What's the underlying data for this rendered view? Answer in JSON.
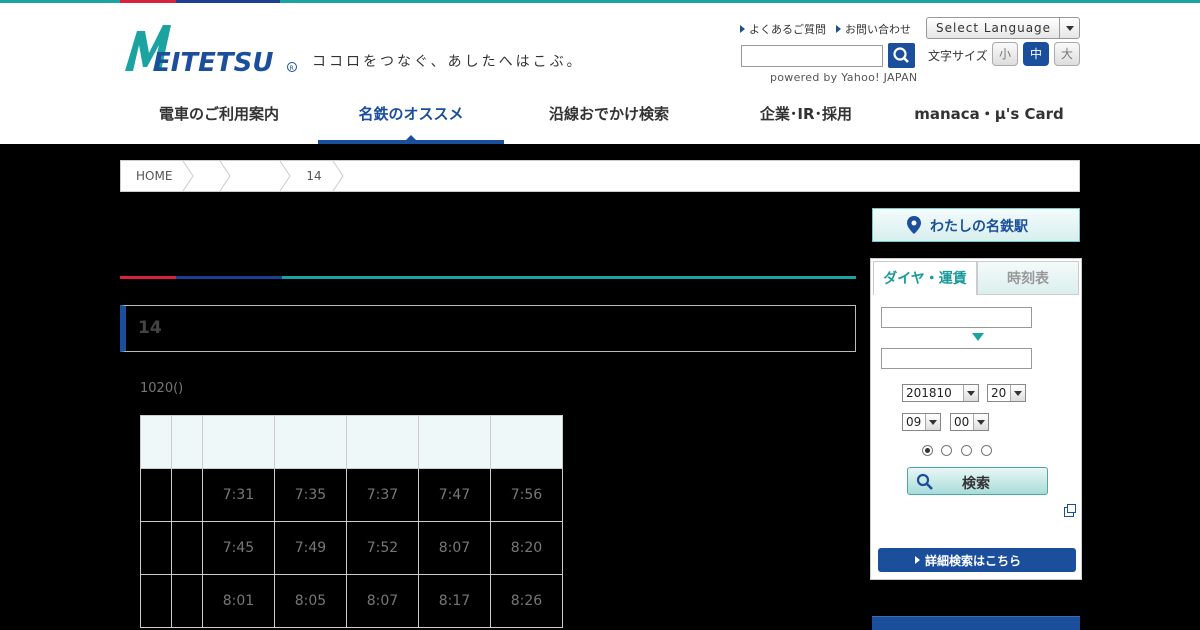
{
  "header": {
    "logo_text": "MEITETSU",
    "tagline": "ココロをつなぐ、あしたへはこぶ。",
    "util_links": [
      "よくあるご質問",
      "お問い合わせ"
    ],
    "language_select": "Select Language",
    "search_placeholder": "",
    "powered_by": "powered by Yahoo! JAPAN",
    "fontsize_label": "文字サイズ",
    "fontsize_small": "小",
    "fontsize_medium": "中",
    "fontsize_large": "大",
    "brand_blue": "#1b4f9c",
    "brand_teal": "#1aa3a0",
    "brand_red": "#d9233c"
  },
  "gnav": [
    {
      "label": "電車のご利用案内",
      "active": false
    },
    {
      "label": "名鉄のオススメ",
      "active": true
    },
    {
      "label": "沿線おでかけ検索",
      "active": false
    },
    {
      "label": "企業･IR･採用",
      "active": false
    },
    {
      "label": "manaca・μ's Card",
      "active": false
    }
  ],
  "breadcrumb": [
    "HOME",
    "",
    "",
    "14"
  ],
  "main": {
    "page_title": "",
    "section_title": "14",
    "date_note": "1020()",
    "table": {
      "rows": [
        [
          "",
          "",
          "7:31",
          "7:35",
          "7:37",
          "7:47",
          "7:56"
        ],
        [
          "",
          "",
          "7:45",
          "7:49",
          "7:52",
          "8:07",
          "8:20"
        ],
        [
          "",
          "",
          "8:01",
          "8:05",
          "8:07",
          "8:17",
          "8:26"
        ]
      ]
    }
  },
  "sidebar": {
    "my_station": "わたしの名鉄駅",
    "tab_dia": "ダイヤ・運賃",
    "tab_timetable": "時刻表",
    "from_value": "",
    "to_value": "",
    "year_month": "201810",
    "day": "20",
    "hour": "09",
    "minute": "00",
    "search_label": "検索",
    "detail_label": "詳細検索はこちら"
  }
}
